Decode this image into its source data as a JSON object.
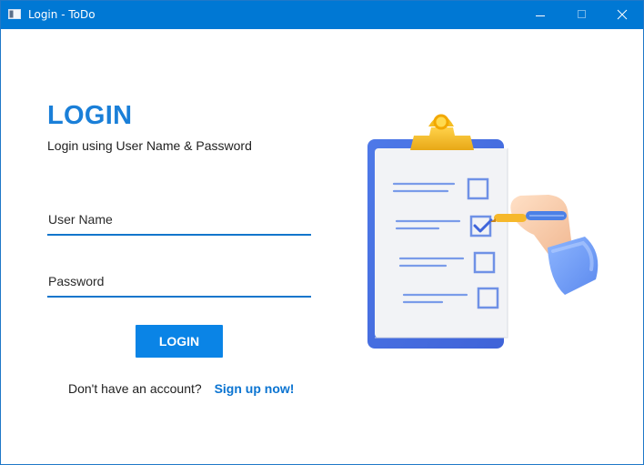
{
  "window": {
    "title": "Login - ToDo",
    "icon": "app-window-icon",
    "controls": [
      "minimize-icon",
      "maximize-icon",
      "close-icon"
    ]
  },
  "login": {
    "title": "LOGIN",
    "subtitle": "Login using User Name & Password",
    "username_placeholder": "User Name",
    "username_value": "",
    "password_placeholder": "Password",
    "password_value": "",
    "button_label": "LOGIN",
    "no_account_text": "Don't have an account?",
    "signup_link": "Sign up now!"
  },
  "illustration": {
    "icon": "clipboard-checklist-illustration"
  },
  "colors": {
    "titlebar": "#0078d4",
    "accent": "#1a7fd8",
    "button": "#0a84e6",
    "link": "#0b74d1"
  }
}
